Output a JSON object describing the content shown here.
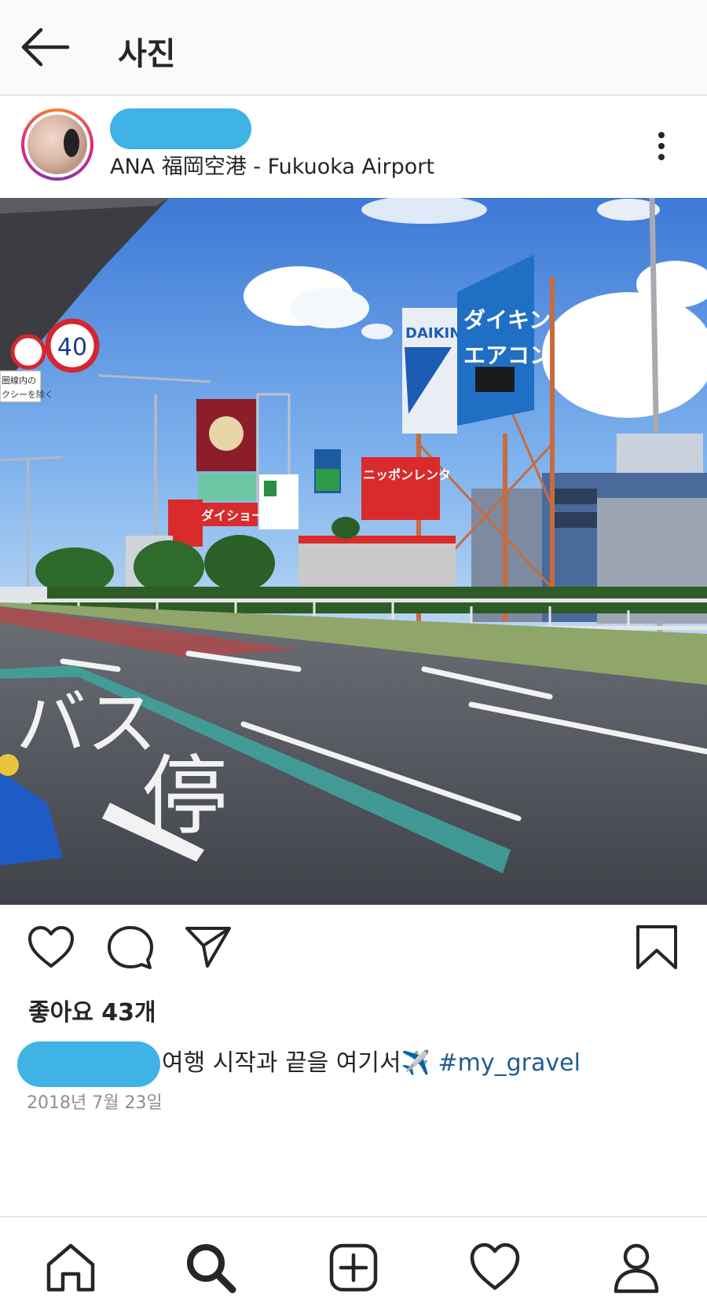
{
  "topbar": {
    "title": "사진",
    "back_icon": "arrow-left-icon"
  },
  "post": {
    "location": "ANA 福岡空港 - Fukuoka Airport",
    "more_icon": "more-vertical-icon",
    "likes": "좋아요 43개",
    "caption": "여행 시작과 끝을 여기서✈️",
    "hashtag": "#my_gravel",
    "date": "2018년 7월 23일",
    "photo": {
      "speed_sign": "40",
      "sign_japanese_left": "圏線内の",
      "sign_japanese_left2": "クシーを除く",
      "billboard_daikin_brand": "DAIKIN",
      "billboard_daikin_text1": "ダイキン",
      "billboard_daikin_text2": "エアコン",
      "billboard_rent": "ニッポンレンタ",
      "billboard_daisho": "ダイショー",
      "road_marking_1": "バス",
      "road_marking_2": "停"
    }
  },
  "actions": {
    "like_icon": "heart-icon",
    "comment_icon": "comment-icon",
    "share_icon": "send-icon",
    "save_icon": "bookmark-icon"
  },
  "nav": {
    "home_icon": "home-icon",
    "search_icon": "search-icon",
    "add_icon": "add-post-icon",
    "activity_icon": "heart-icon",
    "profile_icon": "profile-icon"
  },
  "colors": {
    "privacy_mask": "#3fb2e6",
    "hashtag": "#1f5c8f",
    "date": "#8e8e8e"
  }
}
